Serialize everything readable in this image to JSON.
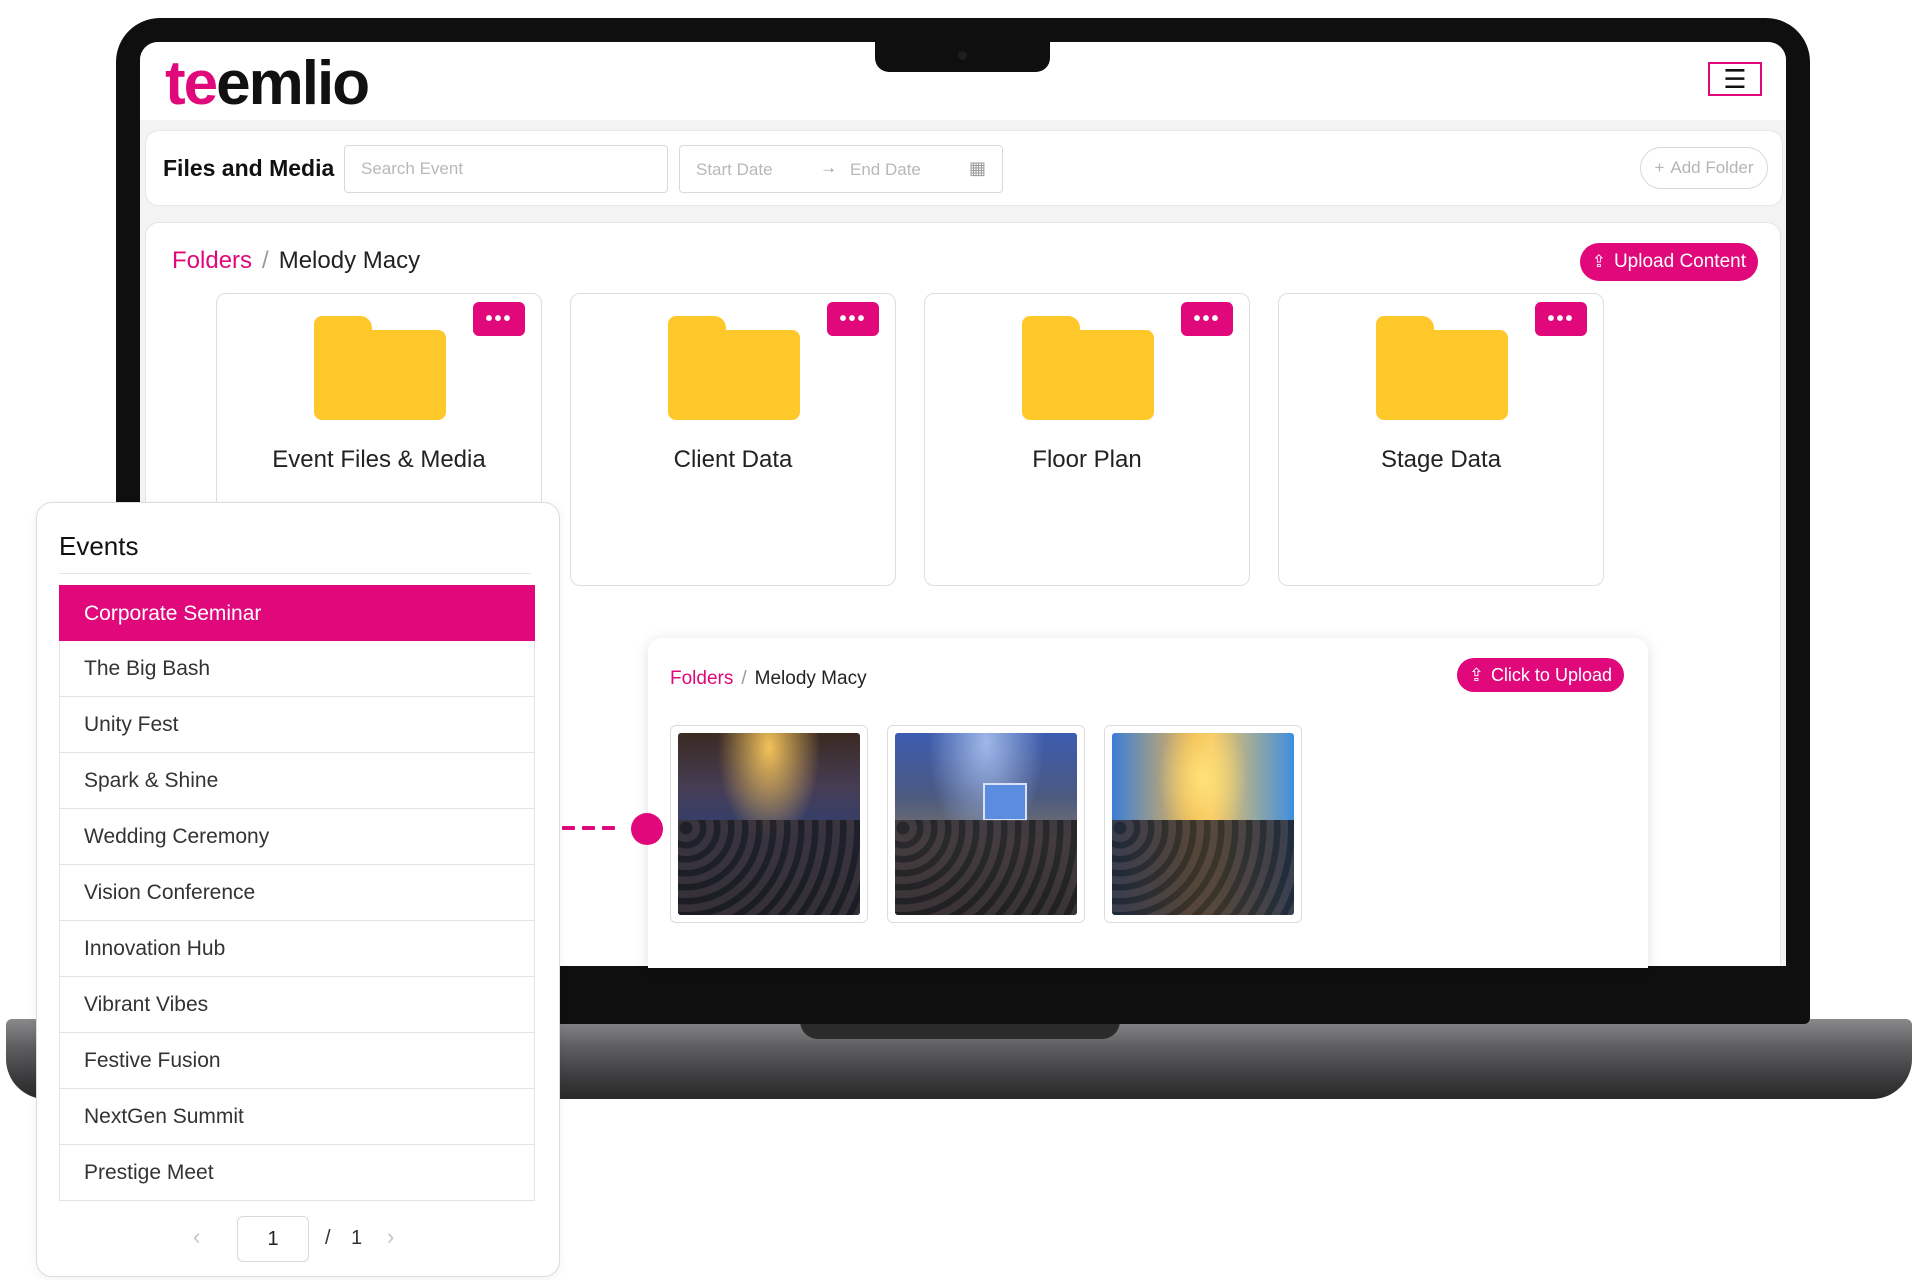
{
  "brand": {
    "logo_start": "te",
    "logo_rest": "emlio",
    "accent": "#e0087a"
  },
  "header": {
    "menu_icon": "hamburger-icon"
  },
  "toolbar": {
    "title": "Files and Media",
    "search_placeholder": "Search Event",
    "start_date_placeholder": "Start Date",
    "end_date_placeholder": "End Date",
    "add_folder_label": "Add Folder"
  },
  "main": {
    "breadcrumb_root": "Folders",
    "breadcrumb_separator": "/",
    "breadcrumb_current": "Melody Macy",
    "upload_label": "Upload Content",
    "folders": [
      {
        "name": "Event Files & Media"
      },
      {
        "name": "Client Data"
      },
      {
        "name": "Floor Plan"
      },
      {
        "name": "Stage Data"
      }
    ],
    "more_label": "•••"
  },
  "inner": {
    "breadcrumb_root": "Folders",
    "breadcrumb_separator": "/",
    "breadcrumb_current": "Melody Macy",
    "upload_label": "Click to Upload"
  },
  "events": {
    "title": "Events",
    "items": [
      "Corporate Seminar",
      "The Big Bash",
      "Unity Fest",
      "Spark & Shine",
      "Wedding Ceremony",
      "Vision Conference",
      "Innovation Hub",
      "Vibrant Vibes",
      "Festive Fusion",
      "NextGen Summit",
      "Prestige Meet"
    ],
    "active_index": 0,
    "pager": {
      "current": "1",
      "separator": "/",
      "total": "1"
    }
  }
}
